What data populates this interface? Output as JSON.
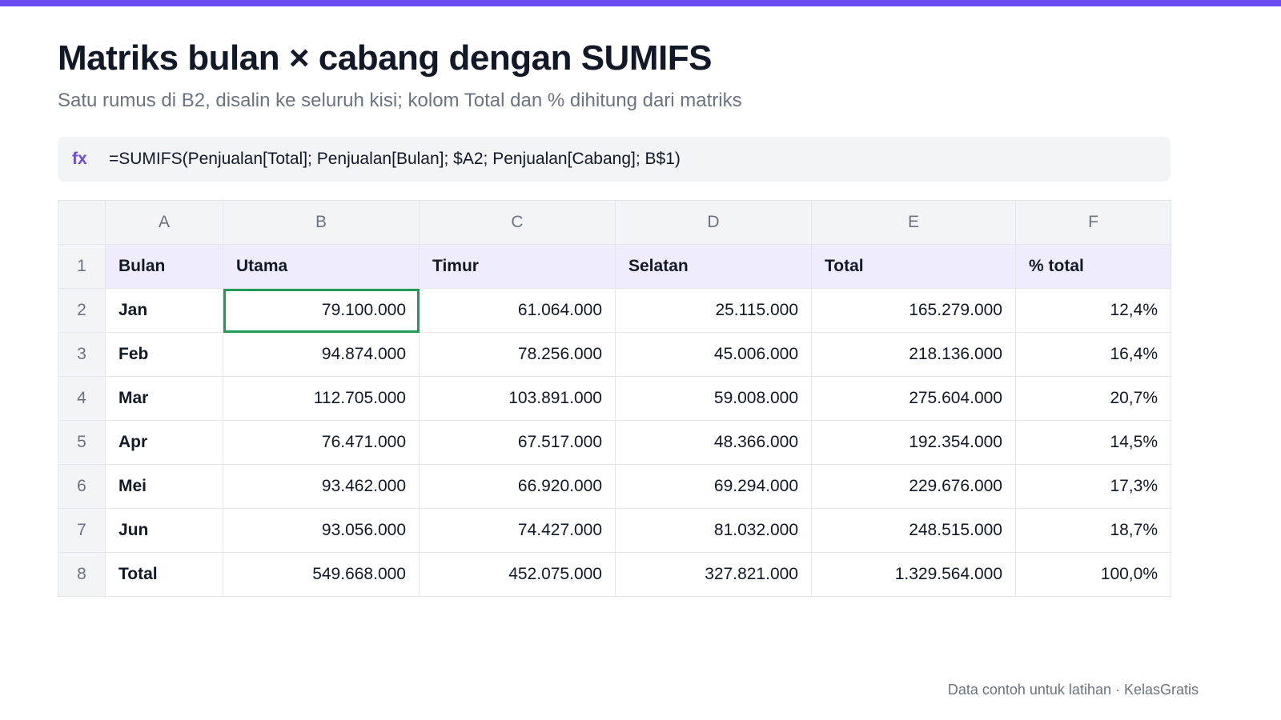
{
  "colors": {
    "accent": "#6c4cf1",
    "header_row_bg": "#efedfd",
    "selection": "#1f9d55"
  },
  "header": {
    "title": "Matriks bulan × cabang dengan SUMIFS",
    "subtitle": "Satu rumus di B2, disalin ke seluruh kisi; kolom Total dan % dihitung dari matriks"
  },
  "formula_bar": {
    "icon": "fx-icon",
    "label": "fx",
    "formula": "=SUMIFS(Penjualan[Total]; Penjualan[Bulan]; $A2; Penjualan[Cabang]; B$1)"
  },
  "sheet": {
    "columns": [
      "A",
      "B",
      "C",
      "D",
      "E",
      "F"
    ],
    "selected_cell": "B2",
    "rows": [
      {
        "num": "1",
        "header": true,
        "cells": [
          "Bulan",
          "Utama",
          "Timur",
          "Selatan",
          "Total",
          "% total"
        ]
      },
      {
        "num": "2",
        "cells": [
          "Jan",
          "79.100.000",
          "61.064.000",
          "25.115.000",
          "165.279.000",
          "12,4%"
        ]
      },
      {
        "num": "3",
        "cells": [
          "Feb",
          "94.874.000",
          "78.256.000",
          "45.006.000",
          "218.136.000",
          "16,4%"
        ]
      },
      {
        "num": "4",
        "cells": [
          "Mar",
          "112.705.000",
          "103.891.000",
          "59.008.000",
          "275.604.000",
          "20,7%"
        ]
      },
      {
        "num": "5",
        "cells": [
          "Apr",
          "76.471.000",
          "67.517.000",
          "48.366.000",
          "192.354.000",
          "14,5%"
        ]
      },
      {
        "num": "6",
        "cells": [
          "Mei",
          "93.462.000",
          "66.920.000",
          "69.294.000",
          "229.676.000",
          "17,3%"
        ]
      },
      {
        "num": "7",
        "cells": [
          "Jun",
          "93.056.000",
          "74.427.000",
          "81.032.000",
          "248.515.000",
          "18,7%"
        ]
      },
      {
        "num": "8",
        "cells": [
          "Total",
          "549.668.000",
          "452.075.000",
          "327.821.000",
          "1.329.564.000",
          "100,0%"
        ]
      }
    ]
  },
  "footer": {
    "note": "Data contoh untuk latihan · KelasGratis"
  }
}
